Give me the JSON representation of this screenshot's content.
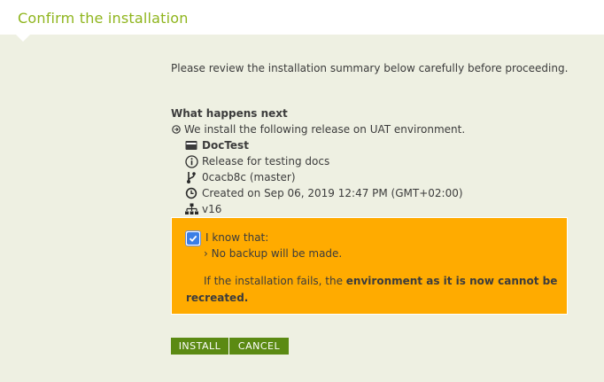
{
  "header": {
    "title": "Confirm the installation"
  },
  "intro": "Please review the installation summary below carefully before proceeding.",
  "what_next": {
    "title": "What happens next",
    "lead": "We install the following release on UAT environment.",
    "items": [
      {
        "icon": "release-card-icon",
        "text": "DocTest"
      },
      {
        "icon": "info-icon",
        "text": "Release for testing docs"
      },
      {
        "icon": "git-branch-icon",
        "text": "0cacb8c (master)"
      },
      {
        "icon": "clock-icon",
        "text": "Created on Sep 06, 2019 12:47 PM (GMT+02:00)"
      },
      {
        "icon": "sitemap-icon",
        "text": "v16"
      }
    ]
  },
  "warning": {
    "checked": true,
    "know_label": "I know that:",
    "bullet": "› No backup will be made.",
    "text_prefix": "If the installation fails, the ",
    "text_bold": "environment as it is now cannot be recreated.",
    "background": "#ffab00"
  },
  "buttons": {
    "install": "INSTALL",
    "cancel": "CANCEL"
  },
  "colors": {
    "title": "#8fb51d",
    "button": "#5b8a13",
    "background": "#eef0e2",
    "checkbox": "#3b7ee6"
  }
}
